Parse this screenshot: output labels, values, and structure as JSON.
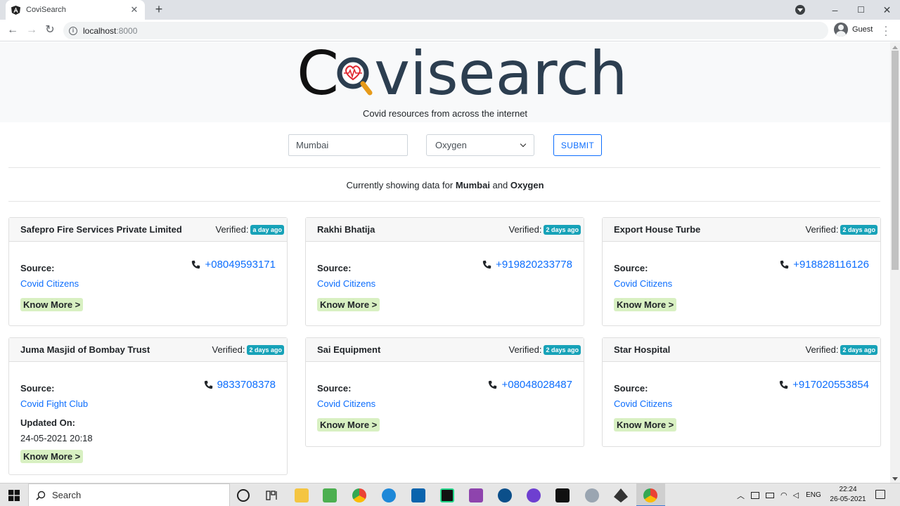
{
  "browser": {
    "tab_title": "CoviSearch",
    "tab_close": "✕",
    "new_tab": "+",
    "url_host": "localhost",
    "url_port": ":8000",
    "profile_label": "Guest",
    "nav": {
      "back": "←",
      "forward": "→",
      "reload": "↻"
    },
    "window": {
      "minimize": "–",
      "maximize": "☐",
      "close": "✕"
    }
  },
  "hero": {
    "logo_prefix": "C",
    "logo_suffix": "visearch",
    "tagline": "Covid resources from across the internet"
  },
  "search": {
    "city_value": "Mumbai",
    "resource_selected": "Oxygen",
    "submit_label": "SUBMIT"
  },
  "status": {
    "prefix": "Currently showing data for ",
    "city": "Mumbai",
    "joiner": " and ",
    "resource": "Oxygen"
  },
  "cards": [
    {
      "name": "Safepro Fire Services Private Limited",
      "verified_label": "Verified:",
      "verified_ago": "a day ago",
      "phone": "+08049593171",
      "source_label": "Source:",
      "source": "Covid Citizens",
      "know_more": "Know More >"
    },
    {
      "name": "Rakhi Bhatija",
      "verified_label": "Verified:",
      "verified_ago": "2 days ago",
      "phone": "+919820233778",
      "source_label": "Source:",
      "source": "Covid Citizens",
      "know_more": "Know More >"
    },
    {
      "name": "Export House Turbe",
      "verified_label": "Verified:",
      "verified_ago": "2 days ago",
      "phone": "+918828116126",
      "source_label": "Source:",
      "source": "Covid Citizens",
      "know_more": "Know More >"
    },
    {
      "name": "Juma Masjid of Bombay Trust",
      "verified_label": "Verified:",
      "verified_ago": "2 days ago",
      "phone": "9833708378",
      "source_label": "Source:",
      "source": "Covid Fight Club",
      "updated_label": "Updated On:",
      "updated_value": "24-05-2021 20:18",
      "know_more": "Know More >"
    },
    {
      "name": "Sai Equipment",
      "verified_label": "Verified:",
      "verified_ago": "2 days ago",
      "phone": "+08048028487",
      "source_label": "Source:",
      "source": "Covid Citizens",
      "know_more": "Know More >"
    },
    {
      "name": "Star Hospital",
      "verified_label": "Verified:",
      "verified_ago": "2 days ago",
      "phone": "+917020553854",
      "source_label": "Source:",
      "source": "Covid Citizens",
      "know_more": "Know More >"
    }
  ],
  "taskbar": {
    "search_placeholder": "Search",
    "language": "ENG",
    "time": "22:24",
    "date": "26-05-2021",
    "pinned_icons": [
      "cortana-icon",
      "task-view-icon",
      "file-explorer-icon",
      "spreadsheet-icon",
      "chrome-icon",
      "edge-icon",
      "mail-icon",
      "pycharm-icon",
      "visual-studio-icon",
      "app-icon",
      "github-icon",
      "terminal-icon",
      "app-icon",
      "app-icon",
      "chrome-active-icon"
    ]
  },
  "colors": {
    "accent": "#0d6efd",
    "badge": "#17a2b8",
    "know_more_bg": "#d8f0c2",
    "logo_text": "#2c3e50",
    "logo_heart": "#e0262f",
    "logo_handle": "#e69a1a"
  }
}
